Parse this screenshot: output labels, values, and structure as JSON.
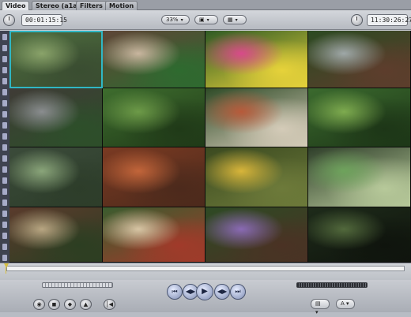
{
  "tabs": [
    {
      "label": "Video",
      "active": true
    },
    {
      "label": "Stereo (a1a2)",
      "active": false
    },
    {
      "label": "Filters",
      "active": false
    },
    {
      "label": "Motion",
      "active": false
    }
  ],
  "toolbar": {
    "duration_timecode": "00:01:15:15",
    "zoom_value": "33%",
    "view_popup_icon": "view-mode-icon",
    "overlay_popup_icon": "overlay-icon",
    "current_timecode": "11:30:26:27"
  },
  "viewer": {
    "tiles": [
      {
        "name": "pond-tile",
        "colors": [
          "#4d6b3e",
          "#8aa36a",
          "#3a4d31"
        ],
        "selected": true
      },
      {
        "name": "rocking-horse-tile",
        "colors": [
          "#5e4536",
          "#c9b69f",
          "#2e6a2f"
        ]
      },
      {
        "name": "tricycle-tile",
        "colors": [
          "#2f5a24",
          "#d84a8a",
          "#e6d23a"
        ]
      },
      {
        "name": "wagon-tile",
        "colors": [
          "#2c4a22",
          "#9fa8a8",
          "#5d3d2c"
        ]
      },
      {
        "name": "windchime-tile",
        "colors": [
          "#3f3b36",
          "#8a8d8f",
          "#2d4f2a"
        ]
      },
      {
        "name": "grass-tile",
        "colors": [
          "#3e6d2e",
          "#6d9a48",
          "#203a18"
        ]
      },
      {
        "name": "rusty-box-tile",
        "colors": [
          "#3d2c22",
          "#6c4a37",
          "#2a201b"
        ]
      },
      {
        "name": "wheel-tile",
        "colors": [
          "#2f4b27",
          "#b75a3a",
          "#d4cbb8"
        ]
      },
      {
        "name": "leaves-tile",
        "colors": [
          "#3b6a2e",
          "#7eab4f",
          "#1d3617"
        ]
      },
      {
        "name": "windmill-tile",
        "colors": [
          "#3b4b3a",
          "#8aa57a",
          "#2d3d2a"
        ]
      },
      {
        "name": "rusty-tray-tile",
        "colors": [
          "#7a3a22",
          "#c2653a",
          "#4c2a1c"
        ]
      },
      {
        "name": "toy-truck-tile",
        "colors": [
          "#3b4a20",
          "#d8b53a",
          "#6d7a3a"
        ]
      },
      {
        "name": "ornament-tile",
        "colors": [
          "#2f3f2a",
          "#6ea35c",
          "#b7c99a"
        ]
      },
      {
        "name": "bust-statue-tile",
        "colors": [
          "#5a3b2c",
          "#b8a682",
          "#2c3e22"
        ]
      },
      {
        "name": "gnome-tile",
        "colors": [
          "#3a5c2e",
          "#d7c5a4",
          "#a13a2a"
        ]
      },
      {
        "name": "flowers-tile",
        "colors": [
          "#2e4a24",
          "#8a6ab4",
          "#4a3224"
        ]
      },
      {
        "name": "big-leaves-tile",
        "colors": [
          "#1e2b1a",
          "#52693c",
          "#0f140d"
        ]
      }
    ]
  },
  "scrubber": {
    "playhead_fraction": 0.0
  },
  "transport": {
    "buttons": [
      {
        "name": "go-to-previous-edit-button",
        "glyph": "⏮"
      },
      {
        "name": "play-in-to-out-button",
        "glyph": "◀▶"
      },
      {
        "name": "play-button",
        "glyph": "▶"
      },
      {
        "name": "play-around-current-button",
        "glyph": "◀▶"
      },
      {
        "name": "go-to-next-edit-button",
        "glyph": "⏭"
      }
    ],
    "small_buttons": [
      {
        "name": "match-frame-button",
        "glyph": "◉"
      },
      {
        "name": "mark-clip-button",
        "glyph": "◼"
      },
      {
        "name": "add-keyframe-button",
        "glyph": "◆"
      },
      {
        "name": "add-marker-button",
        "glyph": "▲"
      },
      {
        "name": "mark-in-out-button",
        "glyph": "⎮◀"
      }
    ],
    "popups": [
      {
        "name": "overwrite-popup",
        "label": "▤ ▾"
      },
      {
        "name": "audio-popup",
        "label": "A ▾"
      }
    ]
  }
}
